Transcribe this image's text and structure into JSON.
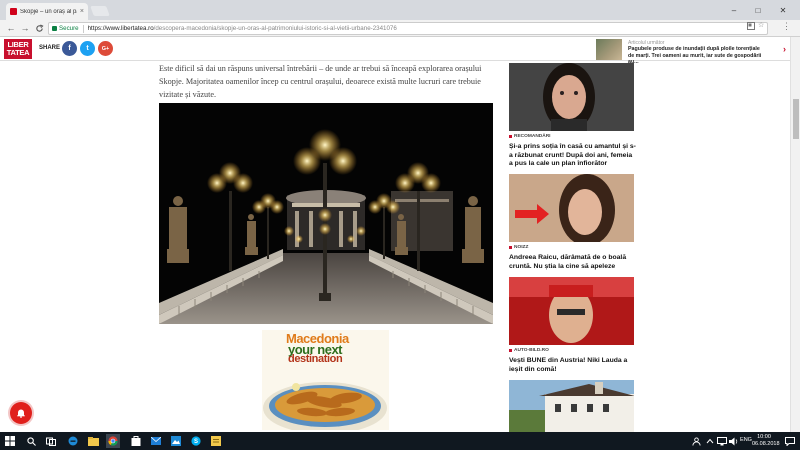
{
  "browser": {
    "tab_title": "Skopje – un oraș al patri",
    "tab_close": "×",
    "back": "←",
    "forward": "→",
    "reload": "C",
    "secure_label": "Secure",
    "url_host": "https://www.libertatea.ro",
    "url_path": "/descopera-macedonia/skopje-un-oras-al-patrimoniului-istoric-si-al-vietii-urbane-2341076",
    "min_btn": "–",
    "max_btn": "□",
    "close_btn": "✕",
    "bookmark_icon": "☆",
    "menu_icon": "⋮"
  },
  "site": {
    "logo_line1": "LIBER",
    "logo_line2": "TATEA",
    "share_label": "SHARE",
    "share_facebook": "f",
    "share_twitter": "t",
    "share_google": "G+",
    "promo_kicker": "Articolul următor",
    "promo_text": "Pagubele produse de inundații după ploile torențiale de marți. Trei oameni au murit, iar sute de gospodării au...",
    "promo_arrow": "›"
  },
  "article": {
    "intro": "Este dificil să dai un răspuns universal întrebării – de unde ar trebui să înceapă explorarea orașului Skopje. Majoritatea oamenilor încep cu centrul orașului, deoarece există multe lucruri care trebuie vizitate și văzute.",
    "ad_line1": "Macedonia",
    "ad_line2": "your next",
    "ad_line3": "destination"
  },
  "sidebar": {
    "items": [
      {
        "kicker": "RECOMANDĂRI",
        "title": "Și-a prins soția în casă cu amantul și s-a răzbunat crunt! După doi ani, femeia a pus la cale un plan înfiorător"
      },
      {
        "kicker": "NOIZZ",
        "title": "Andreea Raicu, dărâmată de o boală cruntă. Nu știa la cine să apeleze"
      },
      {
        "kicker": "AUTO-BILD.RO",
        "title": "Vești BUNE din Austria! Niki Lauda a ieșit din comă!"
      }
    ]
  },
  "taskbar": {
    "language": "ENG",
    "time": "10:00",
    "date": "06.08.2018"
  },
  "colors": {
    "brand": "#c8102e",
    "facebook": "#3b5998",
    "twitter": "#1da1f2",
    "google": "#dd4b39",
    "taskbar": "#101820"
  }
}
